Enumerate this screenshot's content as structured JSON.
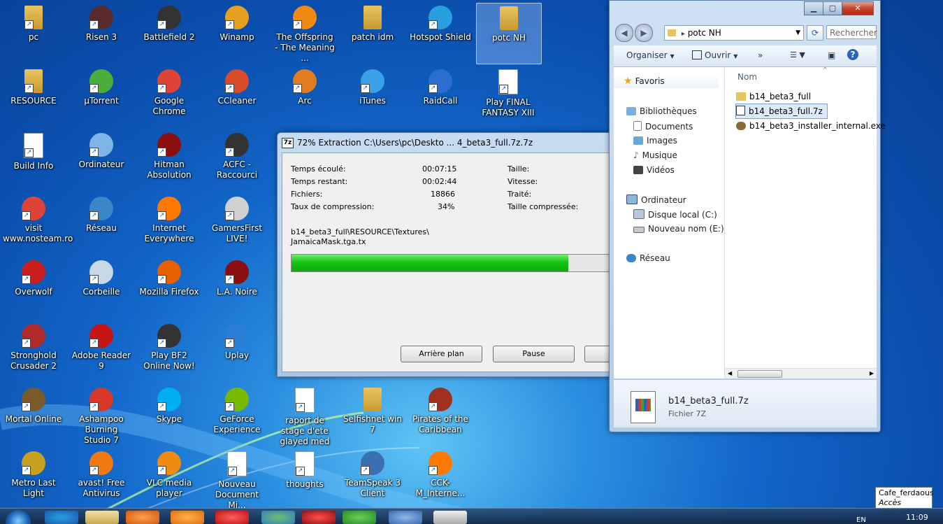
{
  "desktop": {
    "icons": [
      {
        "label": "pc",
        "icon": "folder-icon",
        "color": "#e8c460"
      },
      {
        "label": "Risen 3",
        "icon": "risen-icon",
        "color": "#5a2a2a"
      },
      {
        "label": "Battlefield 2",
        "icon": "battlefield-icon",
        "color": "#333333"
      },
      {
        "label": "Winamp",
        "icon": "winamp-icon",
        "color": "#e8a020"
      },
      {
        "label": "The Offspring - The Meaning ...",
        "icon": "vlc-icon",
        "color": "#f08a10"
      },
      {
        "label": "patch idm",
        "icon": "folder-icon",
        "color": "#e8c460"
      },
      {
        "label": "Hotspot Shield",
        "icon": "shield-icon",
        "color": "#2a9fe0"
      },
      {
        "label": "potc NH",
        "icon": "folder-icon",
        "color": "#e8c460"
      },
      {
        "label": "RESOURCE",
        "icon": "folder-icon",
        "color": "#e8c460"
      },
      {
        "label": "µTorrent",
        "icon": "utorrent-icon",
        "color": "#4cae3a"
      },
      {
        "label": "Google Chrome",
        "icon": "chrome-icon",
        "color": "#db4437"
      },
      {
        "label": "CCleaner",
        "icon": "ccleaner-icon",
        "color": "#d94c2b"
      },
      {
        "label": "Arc",
        "icon": "arc-icon",
        "color": "#e07d20"
      },
      {
        "label": "iTunes",
        "icon": "itunes-icon",
        "color": "#3aa0e8"
      },
      {
        "label": "RaidCall",
        "icon": "raidcall-icon",
        "color": "#2b6ed0"
      },
      {
        "label": "Play FINAL FANTASY XIII",
        "icon": "document-icon",
        "color": "#ffffff"
      },
      {
        "label": "Build Info",
        "icon": "document-icon",
        "color": "#ffffff"
      },
      {
        "label": "Ordinateur",
        "icon": "computer-icon",
        "color": "#7fb5e6"
      },
      {
        "label": "Hitman Absolution",
        "icon": "hitman-icon",
        "color": "#8a1010"
      },
      {
        "label": "ACFC - Raccourci",
        "icon": "acfc-icon",
        "color": "#333333"
      },
      {
        "label": "visit www.nosteam.ro",
        "icon": "chrome-icon",
        "color": "#db4437"
      },
      {
        "label": "Réseau",
        "icon": "network-icon",
        "color": "#3a86c8"
      },
      {
        "label": "Internet Everywhere",
        "icon": "orange-icon",
        "color": "#ff7900"
      },
      {
        "label": "GamersFirst LIVE!",
        "icon": "gamersfirst-icon",
        "color": "#d0d0d0"
      },
      {
        "label": "Overwolf",
        "icon": "overwolf-icon",
        "color": "#c81e1e"
      },
      {
        "label": "Corbeille",
        "icon": "recycle-bin-icon",
        "color": "#c8d8e8"
      },
      {
        "label": "Mozilla Firefox",
        "icon": "firefox-icon",
        "color": "#e66000"
      },
      {
        "label": "L.A. Noire",
        "icon": "lanoire-icon",
        "color": "#8a1010"
      },
      {
        "label": "Stronghold Crusader 2",
        "icon": "stronghold-icon",
        "color": "#b02a2a"
      },
      {
        "label": "Adobe Reader 9",
        "icon": "adobe-reader-icon",
        "color": "#c81414"
      },
      {
        "label": "Play BF2 Online Now!",
        "icon": "battlefield-icon",
        "color": "#333333"
      },
      {
        "label": "Uplay",
        "icon": "uplay-icon",
        "color": "#2a7fd4"
      },
      {
        "label": "Mortal Online",
        "icon": "mortal-online-icon",
        "color": "#7a5a2a"
      },
      {
        "label": "Ashampoo Burning Studio 7",
        "icon": "ashampoo-icon",
        "color": "#d8382a"
      },
      {
        "label": "Skype",
        "icon": "skype-icon",
        "color": "#00aff0"
      },
      {
        "label": "GeForce Experience",
        "icon": "geforce-icon",
        "color": "#76b900"
      },
      {
        "label": "raport de stage d'ete glayed med",
        "icon": "word-document-icon",
        "color": "#ffffff"
      },
      {
        "label": "Selfishnet win 7",
        "icon": "folder-icon",
        "color": "#e8c460"
      },
      {
        "label": "Pirates of the Caribbean",
        "icon": "pirates-icon",
        "color": "#a03020"
      },
      {
        "label": "Metro Last Light",
        "icon": "metro-icon",
        "color": "#c8a020"
      },
      {
        "label": "avast! Free Antivirus",
        "icon": "avast-icon",
        "color": "#f07a10"
      },
      {
        "label": "VLC media player",
        "icon": "vlc-icon",
        "color": "#f08a10"
      },
      {
        "label": "Nouveau Document Mi...",
        "icon": "word-document-icon",
        "color": "#ffffff"
      },
      {
        "label": "thoughts",
        "icon": "word-document-icon",
        "color": "#ffffff"
      },
      {
        "label": "TeamSpeak 3 Client",
        "icon": "teamspeak-icon",
        "color": "#3a70b0"
      },
      {
        "label": "CCK-M_Interne...",
        "icon": "orange-icon",
        "color": "#ff7900"
      }
    ]
  },
  "zip": {
    "title": "72% Extraction C:\\Users\\pc\\Deskto ... 4_beta3_full.7z.7z",
    "app_icon": "7z",
    "elapsed_label": "Temps écoulé:",
    "elapsed_value": "00:07:15",
    "remaining_label": "Temps restant:",
    "remaining_value": "00:02:44",
    "files_label": "Fichiers:",
    "files_value": "18866",
    "ratio_label": "Taux de compression:",
    "ratio_value": "34%",
    "size_label": "Taille:",
    "speed_label": "Vitesse:",
    "processed_label": "Traité:",
    "compressed_label": "Taille compressée:",
    "path_line1": "b14_beta3_full\\RESOURCE\\Textures\\",
    "path_line2": "JamaicaMask.tga.tx",
    "progress_fraction": 0.86,
    "btn_background": "Arrière plan",
    "btn_pause": "Pause"
  },
  "explorer": {
    "address": "potc NH",
    "search_placeholder": "Rechercher",
    "organize": "Organiser",
    "open": "Ouvrir",
    "more": "»",
    "nav": {
      "favorites": "Favoris",
      "libraries": "Bibliothèques",
      "documents": "Documents",
      "images": "Images",
      "music": "Musique",
      "videos": "Vidéos",
      "computer": "Ordinateur",
      "disk_c": "Disque local (C:)",
      "disk_e": "Nouveau nom (E:)",
      "network": "Réseau"
    },
    "column_name": "Nom",
    "files": [
      {
        "name": "b14_beta3_full",
        "icon": "folder-icon"
      },
      {
        "name": "b14_beta3_full.7z",
        "icon": "archive-icon"
      },
      {
        "name": "b14_beta3_installer_internal.exe",
        "icon": "installer-icon"
      }
    ],
    "details_name": "b14_beta3_full.7z",
    "details_type": "Fichier 7Z"
  },
  "taskbar": {
    "lang": "EN",
    "time": "11:09"
  },
  "tooltip": {
    "line1": "Cafe_ferdaous",
    "line2": "Accès Internet"
  }
}
